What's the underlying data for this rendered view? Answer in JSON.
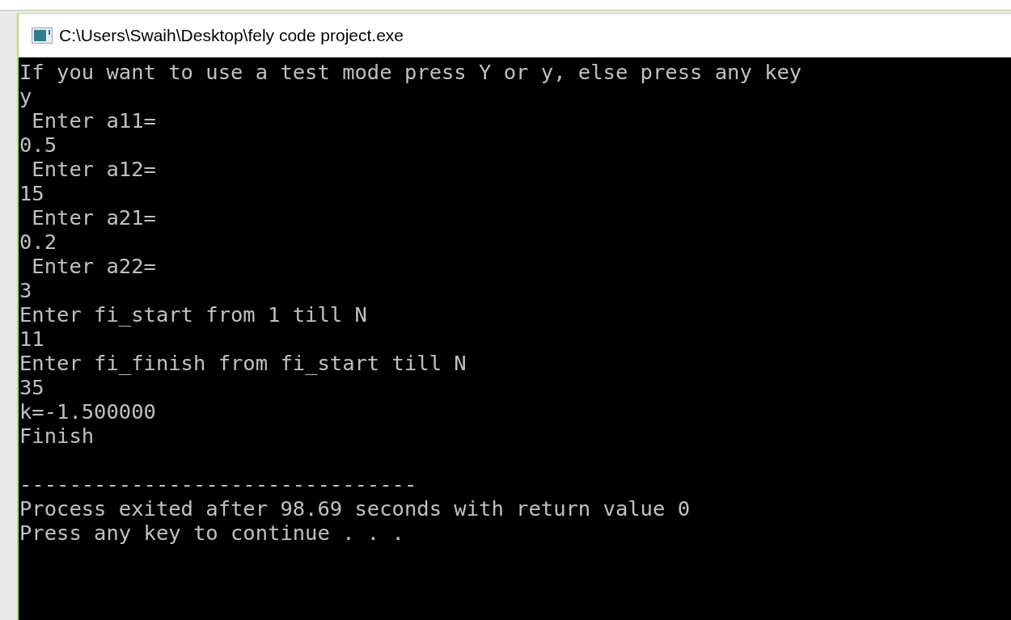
{
  "window": {
    "title": "C:\\Users\\Swaih\\Desktop\\fely code project.exe"
  },
  "console": {
    "program_output": [
      "If you want to use a test mode press Y or y, else press any key",
      "y",
      " Enter a11=",
      "0.5",
      " Enter a12=",
      "15",
      " Enter a21=",
      "0.2",
      " Enter a22=",
      "3",
      "Enter fi_start from 1 till N",
      "11",
      "Enter fi_finish from fi_start till N",
      "35",
      "k=-1.500000",
      "Finish"
    ],
    "exit_message": [
      "--------------------------------",
      "Process exited after 98.69 seconds with return value 0",
      "Press any key to continue . . ."
    ]
  }
}
